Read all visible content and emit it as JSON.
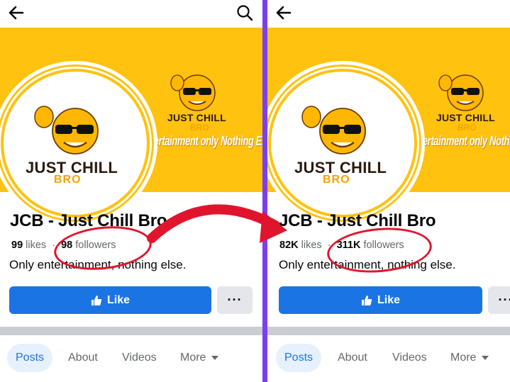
{
  "left": {
    "page_name": "JCB - Just Chill Bro",
    "likes_count": "99",
    "likes_label": "likes",
    "followers_count": "98",
    "followers_label": "followers",
    "bio": "Only entertainment, nothing else.",
    "like_button": "Like",
    "more_button": "···",
    "tabs": [
      "Posts",
      "About",
      "Videos",
      "More"
    ]
  },
  "right": {
    "page_name": "JCB - Just Chill Bro",
    "likes_count": "82K",
    "likes_label": "likes",
    "followers_count": "311K",
    "followers_label": "followers",
    "bio": "Only entertainment, nothing else.",
    "like_button": "Like",
    "more_button": "···",
    "tabs": [
      "Posts",
      "About",
      "Videos",
      "More"
    ]
  },
  "cover": {
    "brand_line1": "JUST CHILL",
    "brand_line2": "BRO",
    "tagline": "Entertainment only Nothing Else"
  },
  "icons": {
    "back": "back-arrow-icon",
    "search": "search-icon",
    "like": "thumbs-up-icon",
    "more": "ellipsis-icon",
    "caret": "caret-down-icon"
  },
  "colors": {
    "cover_yellow": "#ffc20e",
    "primary_blue": "#1b74e4",
    "divider_purple": "#7b3ff2",
    "annotation_red": "#e0152d"
  }
}
